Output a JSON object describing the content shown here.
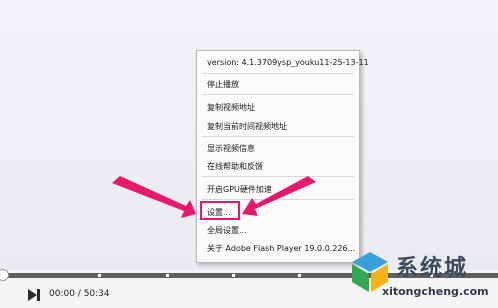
{
  "context_menu": {
    "version": "version: 4.1.3709ysp_youku11-25-13-11",
    "stop_play": "停止播放",
    "copy_video_url": "复制视频地址",
    "copy_time_url": "复制当前时间视频地址",
    "show_info": "显示视频信息",
    "help_feedback": "在线帮助和反馈",
    "gpu_accel": "开启GPU硬件加速",
    "settings": "设置...",
    "global_settings": "全局设置...",
    "about_flash": "关于 Adobe Flash Player 19.0.0.226..."
  },
  "player": {
    "timecode": "00:00 / 50:34",
    "progress": 0
  },
  "watermark": {
    "title": "系统城",
    "url": "xitongcheng.com"
  },
  "colors": {
    "annotation": "#e7186e"
  }
}
